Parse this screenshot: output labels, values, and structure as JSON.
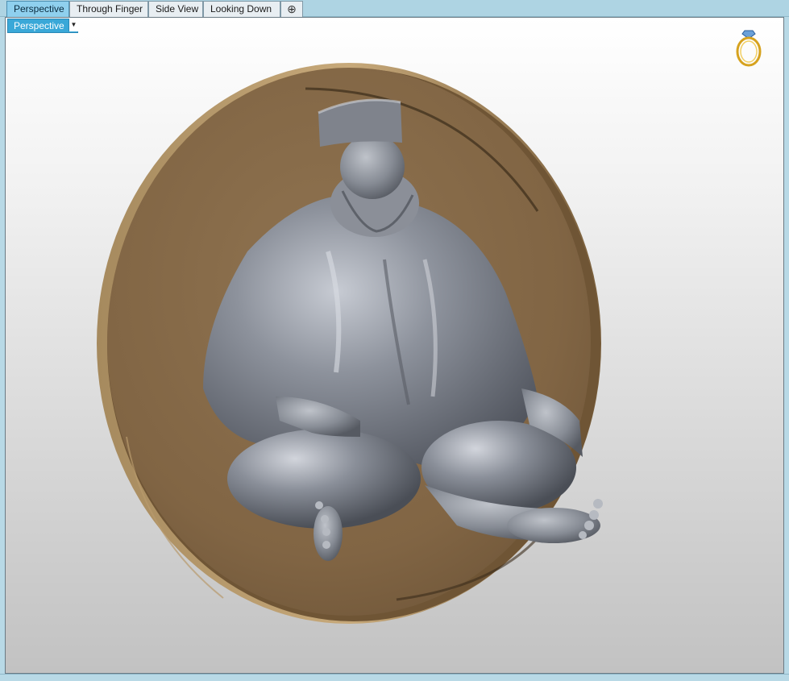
{
  "tabs": [
    {
      "label": "Perspective",
      "active": true
    },
    {
      "label": "Through Finger",
      "active": false
    },
    {
      "label": "Side View",
      "active": false
    },
    {
      "label": "Looking Down",
      "active": false
    }
  ],
  "add_tab_symbol": "⊕",
  "viewport": {
    "label": "Perspective",
    "dropdown_icon": "triangle-down-icon",
    "corner_icon": "ring-icon"
  },
  "colors": {
    "accent": "#3aa8d8",
    "coin": "#8a6d48",
    "figure": "#8a8f9a"
  }
}
